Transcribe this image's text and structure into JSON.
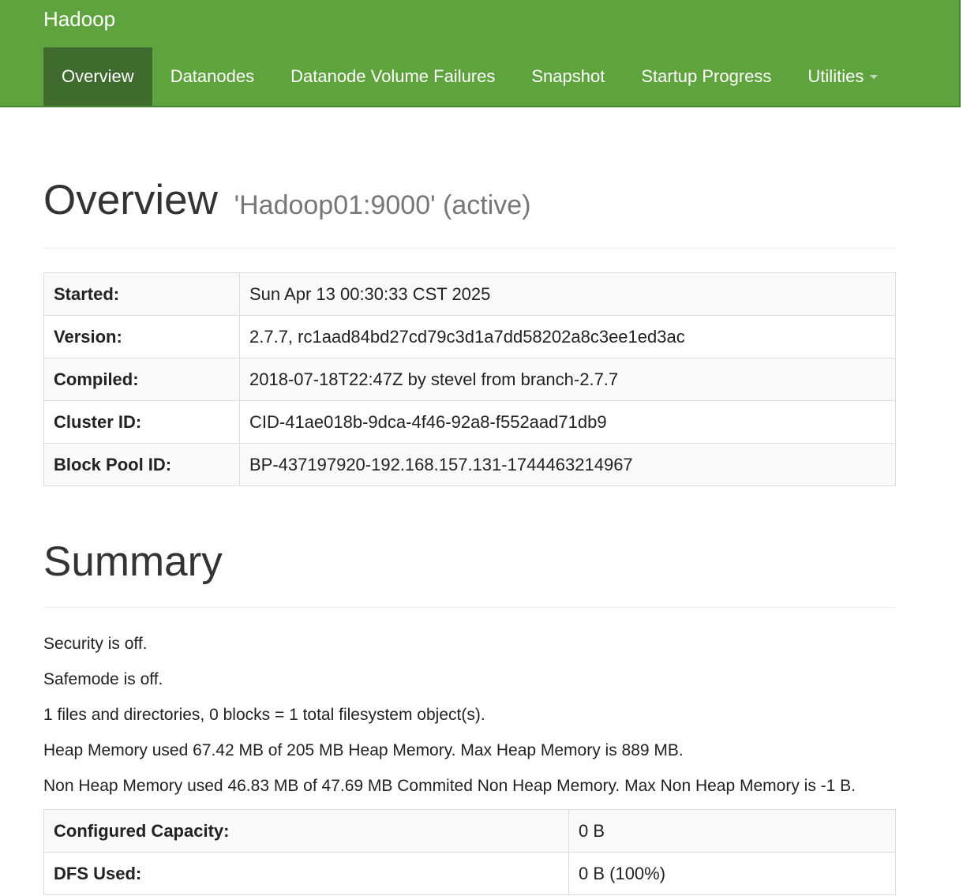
{
  "navbar": {
    "brand": "Hadoop",
    "tabs": [
      {
        "label": "Overview",
        "active": true
      },
      {
        "label": "Datanodes"
      },
      {
        "label": "Datanode Volume Failures"
      },
      {
        "label": "Snapshot"
      },
      {
        "label": "Startup Progress"
      },
      {
        "label": "Utilities",
        "has_dropdown": true
      }
    ]
  },
  "overview": {
    "title": "Overview",
    "subtitle": "'Hadoop01:9000' (active)",
    "rows": [
      {
        "key": "Started:",
        "value": "Sun Apr 13 00:30:33 CST 2025"
      },
      {
        "key": "Version:",
        "value": "2.7.7, rc1aad84bd27cd79c3d1a7dd58202a8c3ee1ed3ac"
      },
      {
        "key": "Compiled:",
        "value": "2018-07-18T22:47Z by stevel from branch-2.7.7"
      },
      {
        "key": "Cluster ID:",
        "value": "CID-41ae018b-9dca-4f46-92a8-f552aad71db9"
      },
      {
        "key": "Block Pool ID:",
        "value": "BP-437197920-192.168.157.131-1744463214967"
      }
    ]
  },
  "summary": {
    "title": "Summary",
    "lines": [
      "Security is off.",
      "Safemode is off.",
      "1 files and directories, 0 blocks = 1 total filesystem object(s).",
      "Heap Memory used 67.42 MB of 205 MB Heap Memory. Max Heap Memory is 889 MB.",
      "Non Heap Memory used 46.83 MB of 47.69 MB Commited Non Heap Memory. Max Non Heap Memory is -1 B."
    ],
    "rows": [
      {
        "key": "Configured Capacity:",
        "value": "0 B"
      },
      {
        "key": "DFS Used:",
        "value": "0 B (100%)"
      }
    ]
  },
  "colors": {
    "navbar": "#5fa33e",
    "navbar_active": "#3f6b2f"
  }
}
